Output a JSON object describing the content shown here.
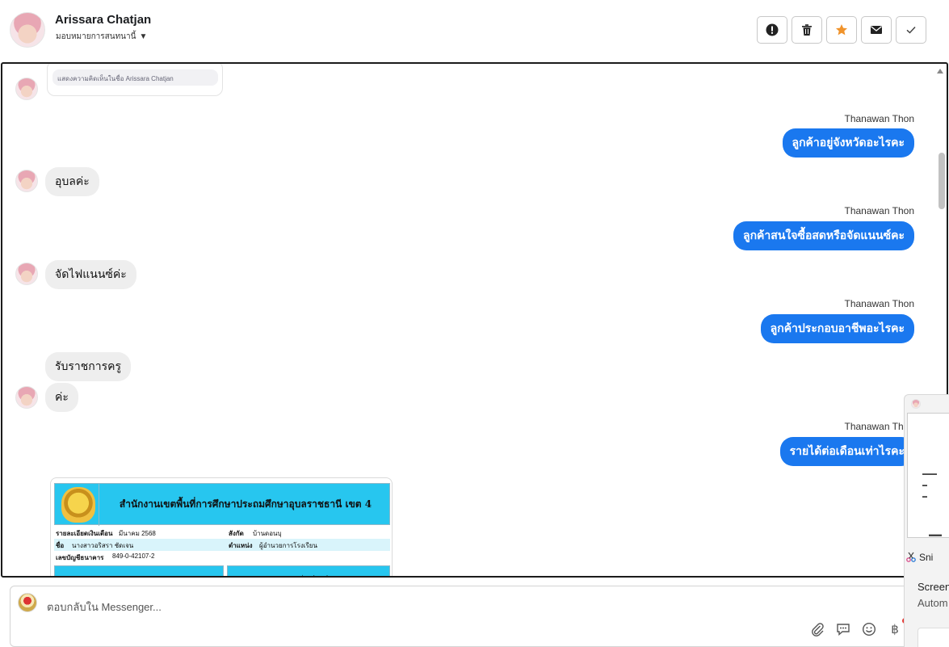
{
  "header": {
    "contact_name": "Arissara Chatjan",
    "assign_label": "มอบหมายการสนทนานี้",
    "actions": [
      {
        "name": "report-button",
        "icon": "exclamation-icon"
      },
      {
        "name": "delete-button",
        "icon": "trash-icon"
      },
      {
        "name": "star-button",
        "icon": "star-icon"
      },
      {
        "name": "mark-unread-button",
        "icon": "envelope-icon"
      },
      {
        "name": "done-button",
        "icon": "check-icon"
      }
    ],
    "star_color": "#f0932b"
  },
  "conversation": {
    "quoted_card_text": "แสดงความคิดเห็นในชื่อ Arissara Chatjan",
    "messages": [
      {
        "sender": "Thanawan Thon",
        "text": "ลูกค้าอยู่จังหวัดอะไรคะ"
      },
      {
        "text": "อุบลค่ะ"
      },
      {
        "sender": "Thanawan Thon",
        "text": "ลูกค้าสนใจซื้อสดหรือจัดแนนซ์คะ"
      },
      {
        "text": "จัดไฟแนนซ์ค่ะ"
      },
      {
        "sender": "Thanawan Thon",
        "text": "ลูกค้าประกอบอาชีพอะไรคะ"
      },
      {
        "text": "รับราชการครู"
      },
      {
        "text": "ค่ะ"
      },
      {
        "sender": "Thanawan Thon",
        "text": "รายได้ต่อเดือนเท่าไรคะ"
      }
    ],
    "outgoing_color": "#1a78ef",
    "incoming_color": "#eeeeee"
  },
  "attachment": {
    "org_title": "สำนักงานเขตพื้นที่การศึกษาประถมศึกษาอุบลราชธานี เขต 4",
    "row1_label": "รายละเอียดเงินเดือน",
    "row1_value": "มีนาคม 2568",
    "row1_label2": "สังกัด",
    "row1_value2": "บ้านดอนบุ",
    "row2_label": "ชื่อ",
    "row2_value": "นางสาวอริสรา ชัดเจน",
    "row2_label2": "ตำแหน่ง",
    "row2_value2": "ผู้อำนวยการโรงเรียน",
    "row3_label": "เลขบัญชีธนาคาร",
    "row3_value": "849-0-42107-2",
    "foot_right": "รายจ่าย (บาท)"
  },
  "composer": {
    "placeholder": "ตอบกลับใน Messenger..."
  },
  "side_panel": {
    "snip_label": "Sni",
    "line1": "Screen",
    "line2": "Autom"
  }
}
